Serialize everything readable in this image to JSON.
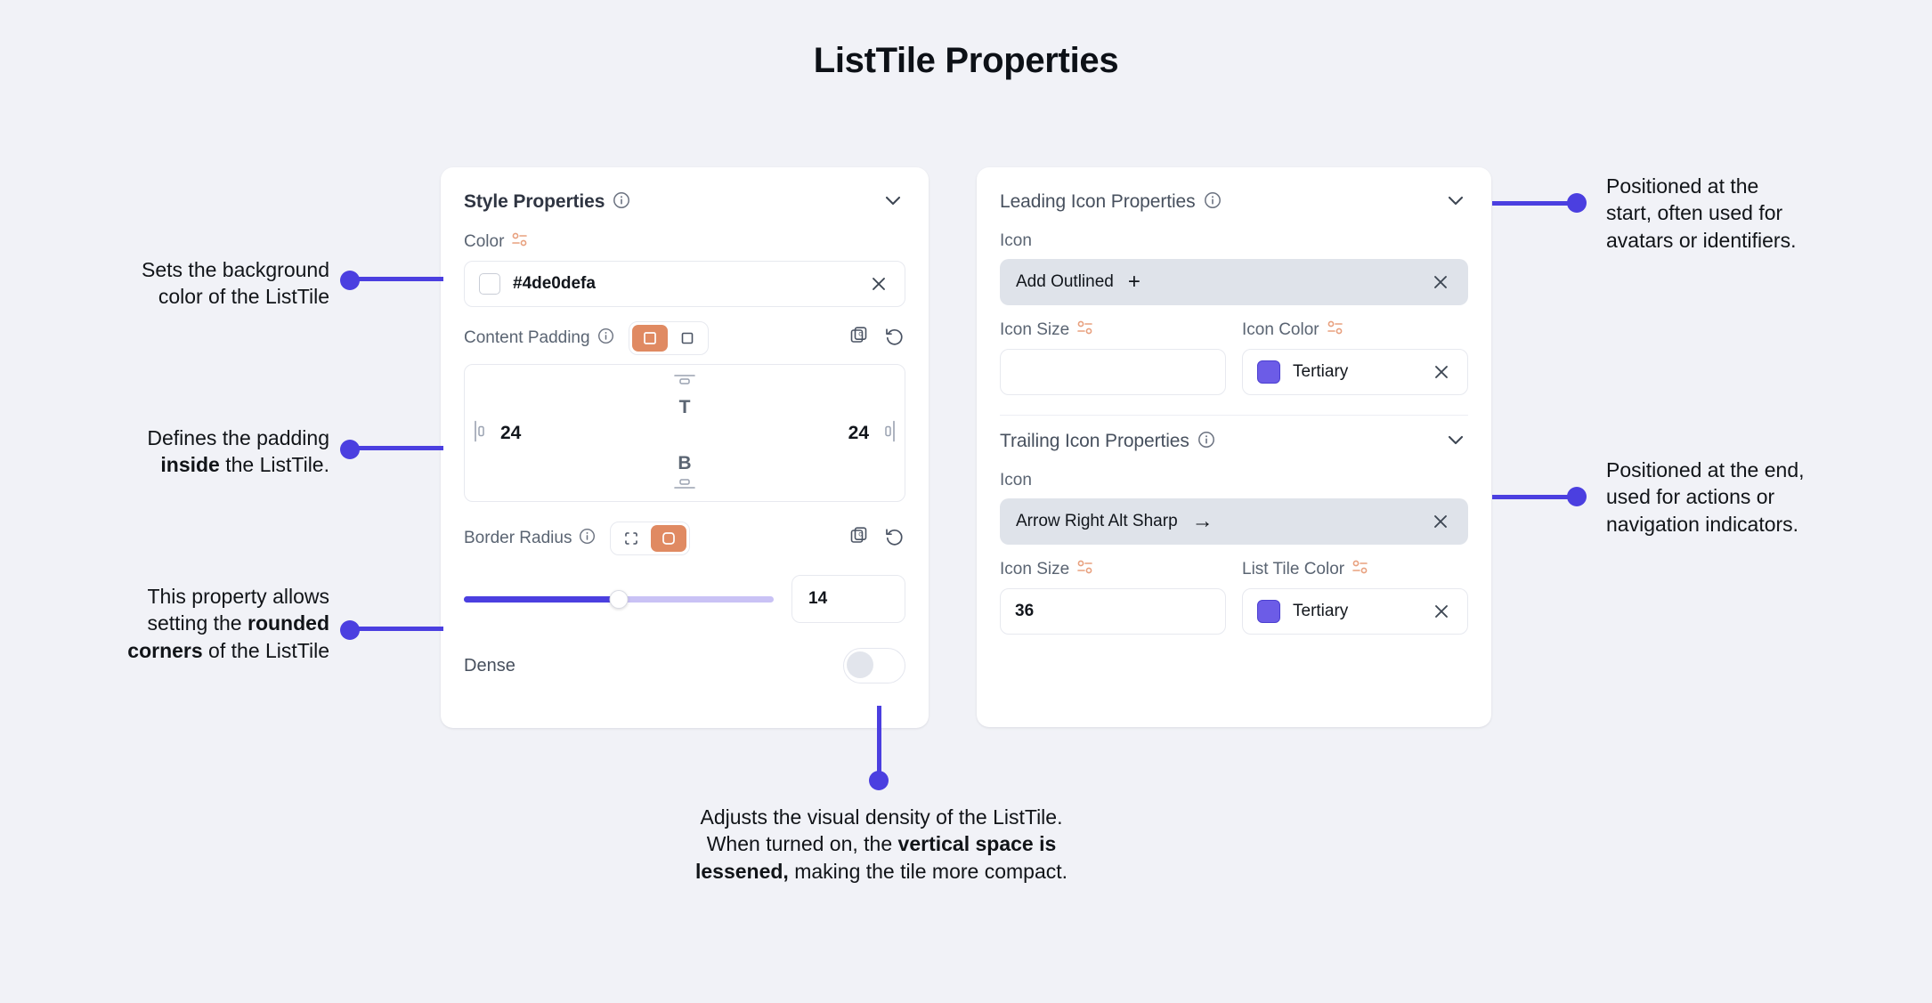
{
  "page": {
    "title": "ListTile Properties",
    "background": "#f1f2f7",
    "accent": "#4b3fe0",
    "orange": "#e08a62",
    "tertiary_swatch": "#6c5ce7"
  },
  "style_panel": {
    "header": "Style Properties",
    "color_label": "Color",
    "color_value": "#4de0defa",
    "content_padding_label": "Content Padding",
    "padding": {
      "top_letter": "T",
      "bottom_letter": "B",
      "left_value": "24",
      "right_value": "24"
    },
    "border_radius_label": "Border Radius",
    "border_radius_value": "14",
    "border_radius_percent": 50,
    "dense_label": "Dense",
    "dense_on": false
  },
  "leading_icon_panel": {
    "header": "Leading Icon Properties",
    "icon_label": "Icon",
    "icon_value": "Add Outlined",
    "icon_glyph": "+",
    "icon_size_label": "Icon Size",
    "icon_size_value": "",
    "icon_color_label": "Icon Color",
    "icon_color_value": "Tertiary"
  },
  "trailing_icon_panel": {
    "header": "Trailing Icon Properties",
    "icon_label": "Icon",
    "icon_value": "Arrow Right Alt Sharp",
    "icon_glyph": "→",
    "icon_size_label": "Icon Size",
    "icon_size_value": "36",
    "list_tile_color_label": "List Tile Color",
    "list_tile_color_value": "Tertiary"
  },
  "annotations": {
    "color": {
      "line1": "Sets the background",
      "line2": "color of the ListTile"
    },
    "padding": {
      "line1": "Defines the padding",
      "bold": "inside",
      "line2_tail": " the ListTile."
    },
    "radius": {
      "line1": "This property allows",
      "line2_head": "setting the ",
      "bold1": "rounded",
      "bold2": "corners",
      "line3_tail": " of the ListTile"
    },
    "dense": {
      "line1": "Adjusts the visual density of the ListTile.",
      "line2_head": "When turned on, the ",
      "bold1": "vertical space is",
      "bold2": "lessened,",
      "line3_tail": " making the tile more compact."
    },
    "leading": {
      "line1": "Positioned at the",
      "line2": "start, often used for",
      "line3": "avatars or identifiers."
    },
    "trailing": {
      "line1": "Positioned at the end,",
      "line2": "used for actions or",
      "line3": "navigation indicators."
    }
  }
}
